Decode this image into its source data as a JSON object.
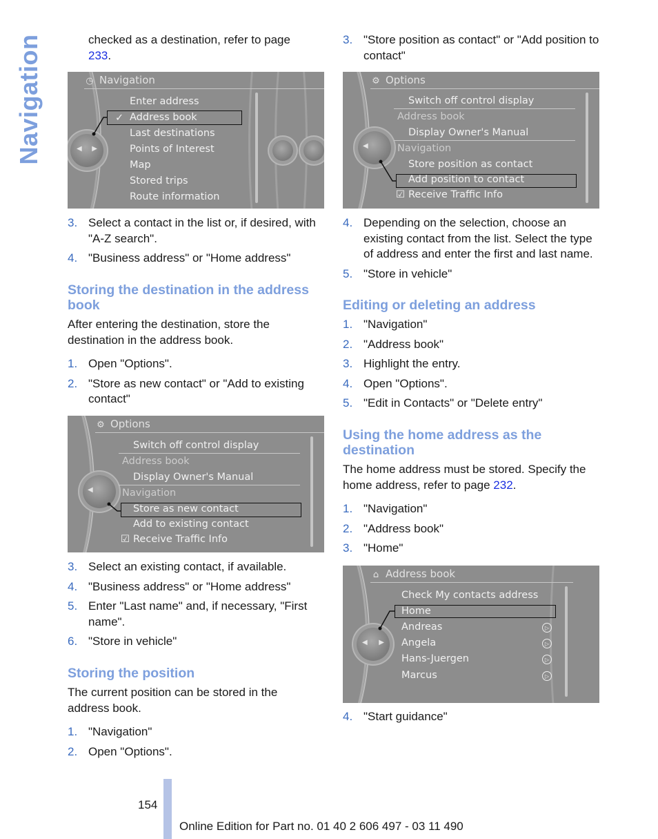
{
  "side_tab": "Navigation",
  "left": {
    "intro": {
      "text": "checked as a destination, refer to page ",
      "link": "233",
      "end": "."
    },
    "screen1": {
      "title": "Navigation",
      "title_icon": "navigation-compass-icon",
      "items": [
        "Enter address",
        "Address book",
        "Last destinations",
        "Points of Interest",
        "Map",
        "Stored trips",
        "Route information"
      ],
      "selected": "Address book",
      "checkmark": "✓"
    },
    "steps_a": [
      {
        "num": "3.",
        "text": "Select a contact in the list or, if desired, with \"A-Z search\"."
      },
      {
        "num": "4.",
        "text": "\"Business address\" or \"Home address\""
      }
    ],
    "heading1": "Storing the destination in the address book",
    "para1": "After entering the destination, store the destination in the address book.",
    "steps_b": [
      {
        "num": "1.",
        "text": "Open \"Options\"."
      },
      {
        "num": "2.",
        "text": "\"Store as new contact\" or \"Add to existing contact\""
      }
    ],
    "screen2": {
      "title": "Options",
      "title_icon": "options-icon",
      "items": [
        {
          "text": "Switch off control display",
          "type": "item"
        },
        {
          "text": "Address book",
          "type": "section"
        },
        {
          "text": "Display Owner's Manual",
          "type": "item"
        },
        {
          "text": "Navigation",
          "type": "section"
        },
        {
          "text": "Store as new contact",
          "type": "item"
        },
        {
          "text": "Add to existing contact",
          "type": "item"
        },
        {
          "text": "Receive Traffic Info",
          "type": "check"
        }
      ],
      "selected": "Store as new contact"
    },
    "steps_c": [
      {
        "num": "3.",
        "text": "Select an existing contact, if available."
      },
      {
        "num": "4.",
        "text": "\"Business address\" or \"Home address\""
      },
      {
        "num": "5.",
        "text": "Enter \"Last name\" and, if necessary, \"First name\"."
      },
      {
        "num": "6.",
        "text": "\"Store in vehicle\""
      }
    ],
    "heading2": "Storing the position",
    "para2": "The current position can be stored in the address book.",
    "steps_d": [
      {
        "num": "1.",
        "text": "\"Navigation\""
      },
      {
        "num": "2.",
        "text": "Open \"Options\"."
      }
    ]
  },
  "right": {
    "steps_a": [
      {
        "num": "3.",
        "text": "\"Store position as contact\" or \"Add position to contact\""
      }
    ],
    "screen3": {
      "title": "Options",
      "title_icon": "options-icon",
      "items": [
        {
          "text": "Switch off control display",
          "type": "item"
        },
        {
          "text": "Address book",
          "type": "section"
        },
        {
          "text": "Display Owner's Manual",
          "type": "item"
        },
        {
          "text": "Navigation",
          "type": "section"
        },
        {
          "text": "Store position as contact",
          "type": "item"
        },
        {
          "text": "Add position to contact",
          "type": "item"
        },
        {
          "text": "Receive Traffic Info",
          "type": "check"
        }
      ],
      "selected": "Add position to contact"
    },
    "steps_b": [
      {
        "num": "4.",
        "text": "Depending on the selection, choose an existing contact from the list. Select the type of address and enter the first and last name."
      },
      {
        "num": "5.",
        "text": "\"Store in vehicle\""
      }
    ],
    "heading1": "Editing or deleting an address",
    "steps_c": [
      {
        "num": "1.",
        "text": "\"Navigation\""
      },
      {
        "num": "2.",
        "text": "\"Address book\""
      },
      {
        "num": "3.",
        "text": "Highlight the entry."
      },
      {
        "num": "4.",
        "text": "Open \"Options\"."
      },
      {
        "num": "5.",
        "text": "\"Edit in Contacts\" or \"Delete entry\""
      }
    ],
    "heading2": "Using the home address as the destination",
    "para2": {
      "text": "The home address must be stored. Specify the home address, refer to page ",
      "link": "232",
      "end": "."
    },
    "steps_d": [
      {
        "num": "1.",
        "text": "\"Navigation\""
      },
      {
        "num": "2.",
        "text": "\"Address book\""
      },
      {
        "num": "3.",
        "text": "\"Home\""
      }
    ],
    "screen4": {
      "title": "Address book",
      "title_icon": "address-book-icon",
      "items": [
        "Check My contacts address",
        "Home",
        "Andreas",
        "Angela",
        "Hans-Juergen",
        "Marcus"
      ],
      "selected": "Home",
      "row_icon": "navigate-to-icon"
    },
    "steps_e": [
      {
        "num": "4.",
        "text": "\"Start guidance\""
      }
    ]
  },
  "footer": {
    "page_number": "154",
    "edition": "Online Edition for Part no. 01 40 2 606 497 - 03 11 490"
  },
  "colors": {
    "heading": "#7d9fdd",
    "list_number": "#3a6bbf",
    "link": "#1a2fe0",
    "screen_bg": "#8d8d8d",
    "footer_bar": "#b5c3e6"
  }
}
